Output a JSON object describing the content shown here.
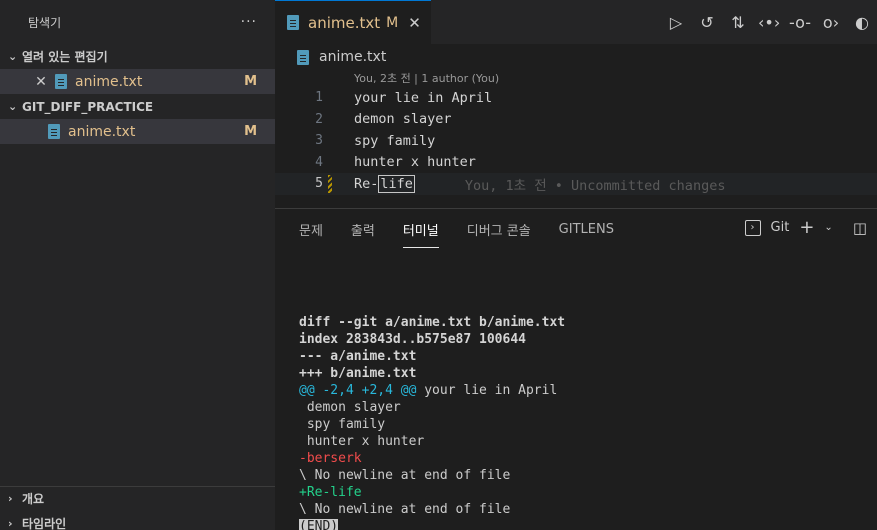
{
  "sidebar": {
    "title": "탐색기",
    "more": "···",
    "open_editors": {
      "header": "열려 있는 편집기",
      "items": [
        {
          "name": "anime.txt",
          "status": "M"
        }
      ]
    },
    "folder": {
      "header": "GIT_DIFF_PRACTICE",
      "items": [
        {
          "name": "anime.txt",
          "status": "M"
        }
      ]
    },
    "bottom": [
      "개요",
      "타임라인"
    ]
  },
  "tab": {
    "name": "anime.txt",
    "status": "M"
  },
  "breadcrumb": "anime.txt",
  "codelens": "You, 2초 전 | 1 author (You)",
  "lines": [
    {
      "n": "1",
      "text": "your lie in April"
    },
    {
      "n": "2",
      "text": "demon slayer"
    },
    {
      "n": "3",
      "text": "spy family"
    },
    {
      "n": "4",
      "text": "hunter x hunter"
    },
    {
      "n": "5",
      "text_a": "Re-",
      "text_b": "life",
      "blame": "You, 1초 전 • Uncommitted changes"
    }
  ],
  "panel": {
    "tabs": [
      "문제",
      "출력",
      "터미널",
      "디버그 콘솔",
      "GITLENS"
    ],
    "active_tab": "터미널",
    "terminal_name": "Git"
  },
  "terminal": {
    "l1": "diff --git a/anime.txt b/anime.txt",
    "l2": "index 283843d..b575e87 100644",
    "l3": "--- a/anime.txt",
    "l4": "+++ b/anime.txt",
    "l5_hunk": "@@ -2,4 +2,4 @@",
    "l5_ctx": " your lie in April",
    "l6": " demon slayer",
    "l7": " spy family",
    "l8": " hunter x hunter",
    "l9": "-berserk",
    "l10": "\\ No newline at end of file",
    "l11": "+Re-life",
    "l12": "\\ No newline at end of file",
    "l13": "(END)"
  },
  "colors": {
    "modified": "#e2c08d",
    "accent": "#0078d4",
    "removed": "#f14c4c",
    "added": "#23d18b",
    "hunk": "#29b8db"
  }
}
